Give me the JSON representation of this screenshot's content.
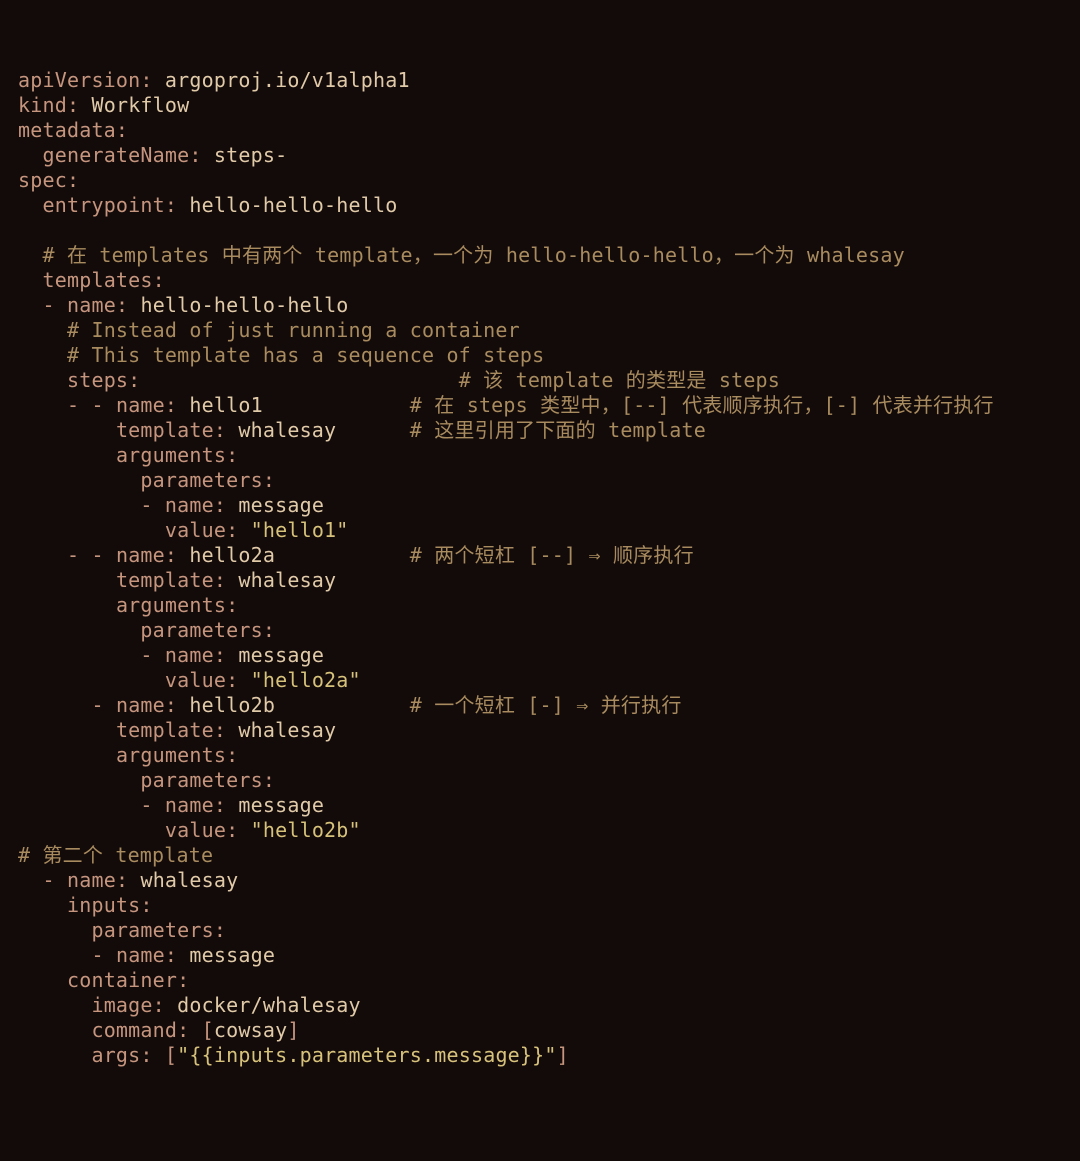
{
  "l1": {
    "k": "apiVersion:",
    "v": "argoproj.io/v1alpha1"
  },
  "l2": {
    "k": "kind:",
    "v": "Workflow"
  },
  "l3": {
    "k": "metadata:"
  },
  "l4": {
    "k": "generateName:",
    "v": "steps-"
  },
  "l5": {
    "k": "spec:"
  },
  "l6": {
    "k": "entrypoint:",
    "v": "hello-hello-hello"
  },
  "l7": {
    "c": "# 在 templates 中有两个 template，一个为 hello-hello-hello，一个为 whalesay"
  },
  "l8": {
    "k": "templates:"
  },
  "l9": {
    "d": "-",
    "k": "name:",
    "v": "hello-hello-hello"
  },
  "l10": {
    "c": "# Instead of just running a container"
  },
  "l11": {
    "c": "# This template has a sequence of steps"
  },
  "l12": {
    "k": "steps:",
    "c": "# 该 template 的类型是 steps"
  },
  "l13": {
    "d": "- -",
    "k": "name:",
    "v": "hello1",
    "c": "# 在 steps 类型中，[--] 代表顺序执行，[-] 代表并行执行"
  },
  "l14": {
    "k": "template:",
    "v": "whalesay",
    "c": "# 这里引用了下面的 template"
  },
  "l15": {
    "k": "arguments:"
  },
  "l16": {
    "k": "parameters:"
  },
  "l17": {
    "d": "-",
    "k": "name:",
    "v": "message"
  },
  "l18": {
    "k": "value:",
    "s": "\"hello1\""
  },
  "l19": {
    "d": "- -",
    "k": "name:",
    "v": "hello2a",
    "c": "# 两个短杠 [--] ⇒ 顺序执行"
  },
  "l20": {
    "k": "template:",
    "v": "whalesay"
  },
  "l21": {
    "k": "arguments:"
  },
  "l22": {
    "k": "parameters:"
  },
  "l23": {
    "d": "-",
    "k": "name:",
    "v": "message"
  },
  "l24": {
    "k": "value:",
    "s": "\"hello2a\""
  },
  "l25": {
    "d": "-",
    "k": "name:",
    "v": "hello2b",
    "c": "# 一个短杠 [-] ⇒ 并行执行"
  },
  "l26": {
    "k": "template:",
    "v": "whalesay"
  },
  "l27": {
    "k": "arguments:"
  },
  "l28": {
    "k": "parameters:"
  },
  "l29": {
    "d": "-",
    "k": "name:",
    "v": "message"
  },
  "l30": {
    "k": "value:",
    "s": "\"hello2b\""
  },
  "l31": {
    "c": "# 第二个 template"
  },
  "l32": {
    "d": "-",
    "k": "name:",
    "v": "whalesay"
  },
  "l33": {
    "k": "inputs:"
  },
  "l34": {
    "k": "parameters:"
  },
  "l35": {
    "d": "-",
    "k": "name:",
    "v": "message"
  },
  "l36": {
    "k": "container:"
  },
  "l37": {
    "k": "image:",
    "v": "docker/whalesay"
  },
  "l38": {
    "k": "command:",
    "lb": "[",
    "v": "cowsay",
    "rb": "]"
  },
  "l39": {
    "k": "args:",
    "lb": "[",
    "s": "\"{{inputs.parameters.message}}\"",
    "rb": "]"
  }
}
